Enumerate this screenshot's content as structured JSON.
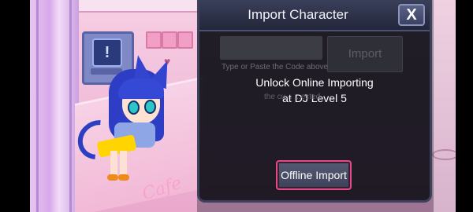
{
  "dialog": {
    "title": "Import Character",
    "close_label": "X",
    "code_input_placeholder": "",
    "import_label": "Import",
    "input_hint": "Type or Paste the Code above",
    "faded_hint": "the cu...    ...ected.",
    "unlock_line1": "Unlock Online Importing",
    "unlock_line2": "at DJ Level 5",
    "offline_import_label": "Offline Import"
  },
  "scene": {
    "screen_glyph": "!",
    "heart": "♥",
    "neon_sign": "Cafe"
  },
  "colors": {
    "accent_border": "#e44a8b",
    "dialog_bg": "#0e0e16",
    "header_bg": "#3a3f5a",
    "hair": "#2d3ec5",
    "skirt": "#ffd400"
  },
  "icons": {
    "close": "close-icon",
    "screen": "alert-icon",
    "heart": "heart-icon"
  }
}
